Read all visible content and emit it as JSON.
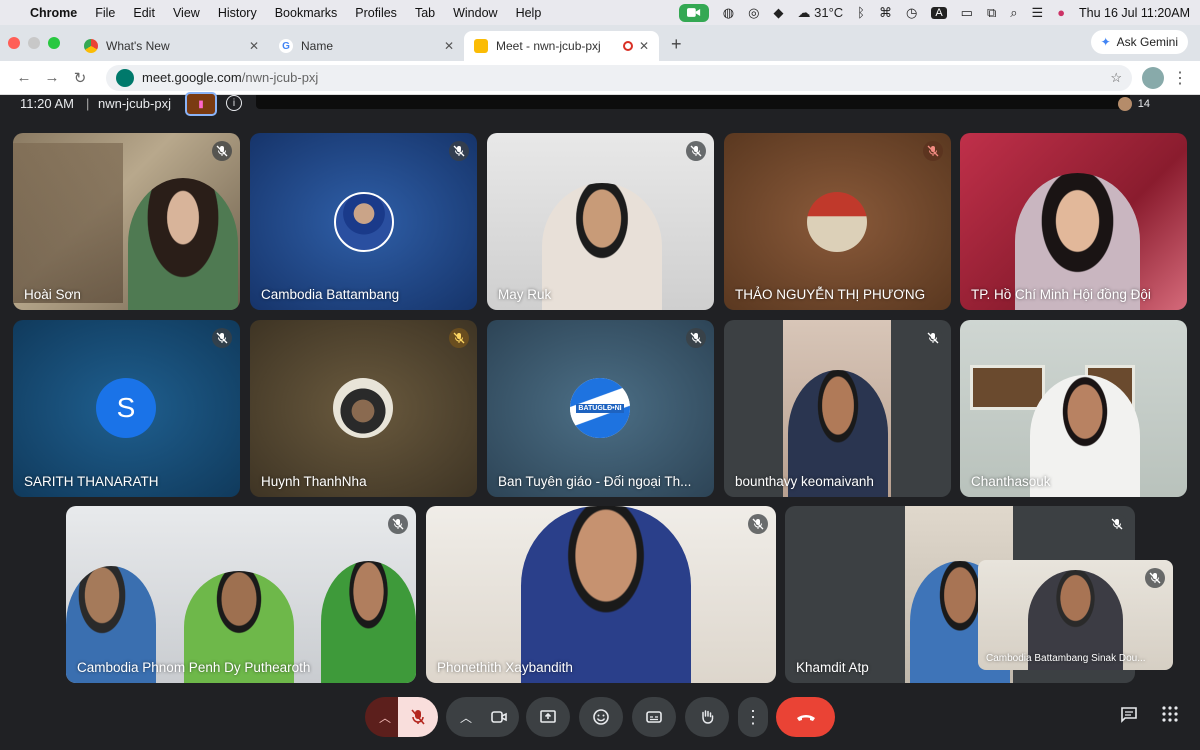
{
  "menubar": {
    "app": "Chrome",
    "items": [
      "File",
      "Edit",
      "View",
      "History",
      "Bookmarks",
      "Profiles",
      "Tab",
      "Window",
      "Help"
    ],
    "weather": "31°C",
    "datetime": "Thu 16 Jul  11:20AM"
  },
  "tabs": [
    {
      "label": "What's New",
      "favicon": "chrome-icon"
    },
    {
      "label": "Name",
      "favicon": "google-icon"
    },
    {
      "label": "Meet - nwn-jcub-pxj",
      "favicon": "meet-icon",
      "active": true
    }
  ],
  "ask_gemini": "Ask Gemini",
  "url": {
    "host": "meet.google.com",
    "path": "/nwn-jcub-pxj"
  },
  "meeting": {
    "time": "11:20 AM",
    "separator": "|",
    "code": "nwn-jcub-pxj",
    "participant_count": "14"
  },
  "participants": [
    {
      "name": "Hoài Sơn"
    },
    {
      "name": "Cambodia Battambang"
    },
    {
      "name": "May Ruk"
    },
    {
      "name": "THẢO NGUYỄN THỊ PHƯƠNG"
    },
    {
      "name": "TP. Hồ Chí Minh Hội đồng Đội"
    },
    {
      "name": "SARITH THANARATH",
      "initial": "S"
    },
    {
      "name": "Huynh ThanhNha"
    },
    {
      "name": "Ban Tuyên giáo - Đối ngoại Th..."
    },
    {
      "name": "bounthavy keomaivanh"
    },
    {
      "name": "Chanthasouk"
    },
    {
      "name": "Cambodia Phnom Penh Dy Puthearoth"
    },
    {
      "name": "Phonethith Xaybandith"
    },
    {
      "name": "Khamdit Atp"
    },
    {
      "name": "Cambodia Battambang Sinak Dou..."
    }
  ],
  "avatar_text": {
    "batugl": "BATUGLĐ•NI"
  },
  "colors": {
    "end_call": "#ea4335",
    "mic_muted_bg": "#f9dedc",
    "accent": "#8ab4f8"
  }
}
